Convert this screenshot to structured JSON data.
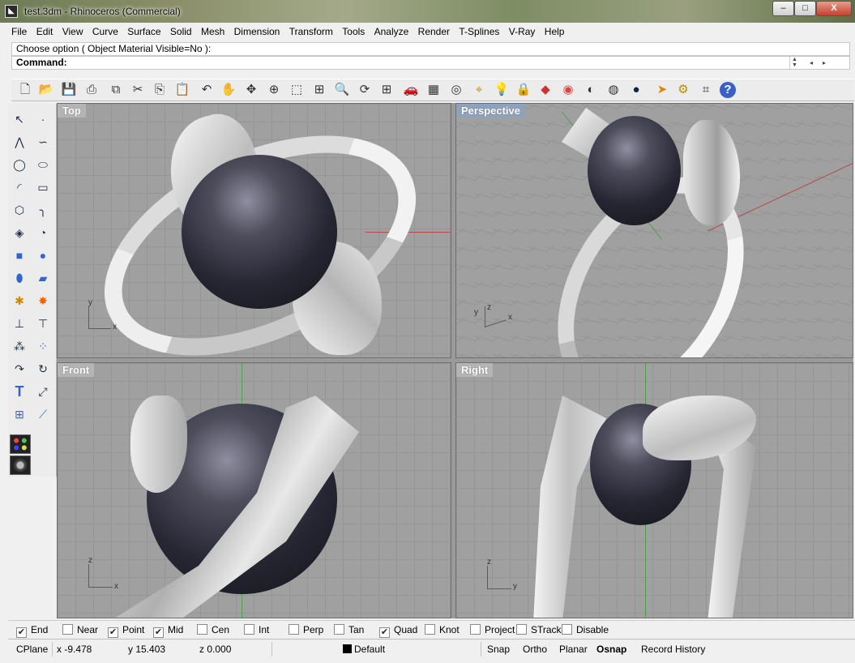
{
  "window": {
    "title": "test.3dm - Rhinoceros (Commercial)",
    "min_label": "–",
    "max_label": "□",
    "close_label": "X"
  },
  "menu": [
    "File",
    "Edit",
    "View",
    "Curve",
    "Surface",
    "Solid",
    "Mesh",
    "Dimension",
    "Transform",
    "Tools",
    "Analyze",
    "Render",
    "T-Splines",
    "V-Ray",
    "Help"
  ],
  "command": {
    "history": "Choose option ( Object  Material  Visible=No ):",
    "prompt": "Command:"
  },
  "toolbar_icons": [
    "new-icon",
    "open-icon",
    "save-icon",
    "print-icon",
    "import-icon",
    "cut-icon",
    "copy-icon",
    "paste-icon",
    "undo-icon",
    "pan-icon",
    "rotate-view-icon",
    "zoom-dynamic-icon",
    "zoom-window-icon",
    "zoom-extents-icon",
    "zoom-selected-icon",
    "rotate-icon",
    "four-viewports-icon",
    "car-icon",
    "grid-icon",
    "cplane-icon",
    "osnap-icon",
    "light-icon",
    "lock-icon",
    "layer-icon",
    "color-wheel-icon",
    "shade-icon",
    "render-preview-icon",
    "render-sphere-icon",
    "select-icon",
    "settings-icon",
    "properties-icon",
    "help-icon"
  ],
  "viewports": {
    "top": {
      "label": "Top",
      "axis1": "y",
      "axis2": "x"
    },
    "perspective": {
      "label": "Perspective",
      "axis1": "y",
      "axis2": "z",
      "axis3": "x"
    },
    "front": {
      "label": "Front",
      "axis1": "z",
      "axis2": "x"
    },
    "right": {
      "label": "Right",
      "axis1": "z",
      "axis2": "y"
    }
  },
  "osnap": [
    {
      "label": "End",
      "checked": true
    },
    {
      "label": "Near",
      "checked": false
    },
    {
      "label": "Point",
      "checked": true
    },
    {
      "label": "Mid",
      "checked": true
    },
    {
      "label": "Cen",
      "checked": false
    },
    {
      "label": "Int",
      "checked": false
    },
    {
      "label": "Perp",
      "checked": false
    },
    {
      "label": "Tan",
      "checked": false
    },
    {
      "label": "Quad",
      "checked": true
    },
    {
      "label": "Knot",
      "checked": false
    },
    {
      "label": "Project",
      "checked": false
    },
    {
      "label": "STrack",
      "checked": false
    },
    {
      "label": "Disable",
      "checked": false
    }
  ],
  "status": {
    "cplane": "CPlane",
    "x": "x -9.478",
    "y": "y 15.403",
    "z": "z 0.000",
    "layer": "Default",
    "snap": "Snap",
    "ortho": "Ortho",
    "planar": "Planar",
    "osnap": "Osnap",
    "record_history": "Record History"
  },
  "colors": {
    "active_viewport_label": "#8da2bd",
    "x_axis": "#b84a4a",
    "y_axis": "#4ea04e"
  }
}
